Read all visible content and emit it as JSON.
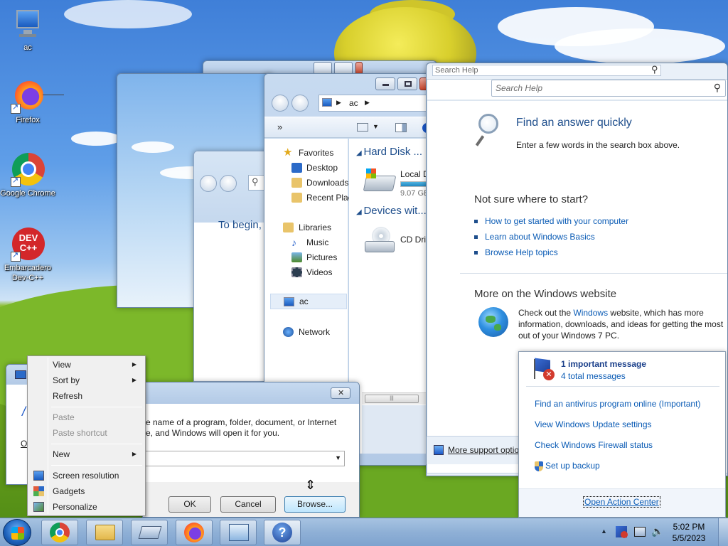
{
  "desktop": {
    "icons": [
      {
        "label": "ac",
        "icon": "computer-icon"
      },
      {
        "label": "Firefox",
        "icon": "firefox-icon"
      },
      {
        "label": "Google Chrome",
        "icon": "chrome-icon"
      },
      {
        "label": "Embarcadero Dev-C++",
        "icon": "devcpp-icon"
      }
    ],
    "devcpp_logo_text": "DEV C++"
  },
  "run_dialog": {
    "description_line1": "e name of a program, folder, document, or Internet",
    "description_line2": "e, and Windows will open it for you.",
    "open_value": "",
    "ok_label": "OK",
    "cancel_label": "Cancel",
    "browse_label": "Browse..."
  },
  "getting_started": {
    "intro_text": "To begin,"
  },
  "explorer": {
    "breadcrumb": [
      "ac"
    ],
    "toolbar_more": "»",
    "favorites": {
      "header": "Favorites",
      "items": [
        "Desktop",
        "Downloads",
        "Recent Plac"
      ]
    },
    "libraries": {
      "header": "Libraries",
      "items": [
        "Music",
        "Pictures",
        "Videos"
      ]
    },
    "computer_label": "ac",
    "network_label": "Network",
    "groups": [
      {
        "title": "Hard Disk ... (",
        "item": "Local D",
        "detail": "9.07 GB",
        "fill": 0.85
      },
      {
        "title": "Devices wit...",
        "item": "CD Driv",
        "detail": ""
      }
    ]
  },
  "help": {
    "search_placeholder_back": "Search Help",
    "search_placeholder": "Search Help",
    "find_title": "Find an answer quickly",
    "find_sub": "Enter a few words in the search box above.",
    "not_sure_title": "Not sure where to start?",
    "links": [
      "How to get started with your computer",
      "Learn about Windows Basics",
      "Browse Help topics"
    ],
    "more_title": "More on the Windows website",
    "more_text_pre": "Check out the ",
    "more_link": "Windows",
    "more_text_post": " website, which has more information, downloads, and ideas for getting the most out of your Windows 7 PC.",
    "more_support": "More support optio"
  },
  "context_menu": {
    "view": "View",
    "sort_by": "Sort by",
    "refresh": "Refresh",
    "paste": "Paste",
    "paste_shortcut": "Paste shortcut",
    "new": "New",
    "screen_resolution": "Screen resolution",
    "gadgets": "Gadgets",
    "personalize": "Personalize"
  },
  "action_center": {
    "important": "1 important message",
    "total": "4 total messages",
    "items": [
      "Find an antivirus program online (Important)",
      "View Windows Update settings",
      "Check Windows Firewall status",
      "Set up backup"
    ],
    "open_label": "Open Action Center"
  },
  "taskbar": {
    "time": "5:02 PM",
    "date": "5/5/2023",
    "apps": [
      "chrome-icon",
      "explorer-icon",
      "run-icon",
      "firefox-icon",
      "control-panel-icon",
      "help-icon"
    ]
  },
  "colors": {
    "link": "#0a5bb5",
    "heading_blue": "#1e4e8c",
    "taskbar": "#8fb0d6"
  }
}
